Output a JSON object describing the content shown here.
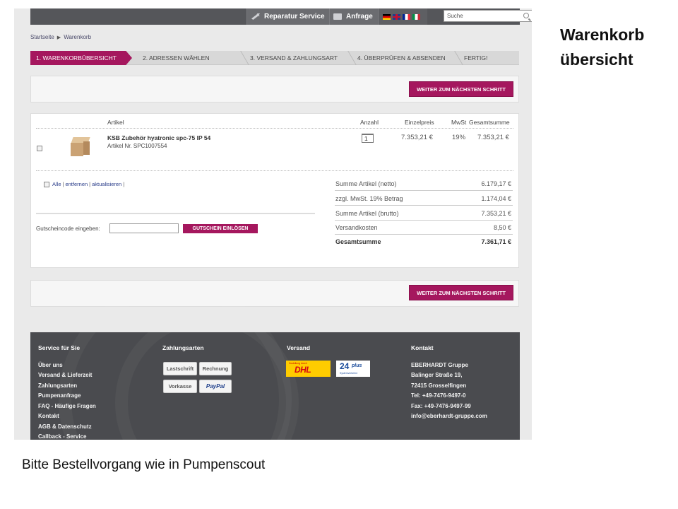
{
  "slide": {
    "title_line1": "Warenkorb",
    "title_line2": "übersicht",
    "note": "Bitte Bestellvorgang wie in Pumpenscout"
  },
  "topbar": {
    "repair_label": "Reparatur Service",
    "request_label": "Anfrage",
    "search_placeholder": "Suche",
    "icons": [
      "wrench-icon",
      "mail-icon",
      "flag-de-icon",
      "flag-uk-icon",
      "flag-fr-icon",
      "flag-it-icon",
      "search-icon"
    ]
  },
  "breadcrumb": {
    "home": "Startseite",
    "current": "Warenkorb"
  },
  "steps": [
    "1. WARENKORBÜBERSICHT",
    "2. ADRESSEN WÄHLEN",
    "3. VERSAND & ZAHLUNGSART",
    "4. ÜBERPRÜFEN & ABSENDEN",
    "FERTIG!"
  ],
  "next_button": "WEITER ZUM NÄCHSTEN SCHRITT",
  "cart": {
    "columns": {
      "article": "Artikel",
      "qty": "Anzahl",
      "unit_price": "Einzelpreis",
      "vat": "MwSt",
      "total": "Gesamtsumme"
    },
    "item": {
      "name": "KSB Zubehör hyatronic spc-75 IP 54",
      "number": "Artikel Nr. SPC1007554",
      "qty": "1",
      "unit_price": "7.353,21 €",
      "vat": "19%",
      "total": "7.353,21 €"
    },
    "links": {
      "all": "Alle",
      "remove": "entfernen",
      "update": "aktualisieren"
    },
    "coupon_label": "Gutscheincode eingeben:",
    "coupon_button": "GUTSCHEIN EINLÖSEN",
    "summary": [
      {
        "label": "Summe Artikel (netto)",
        "value": "6.179,17 €"
      },
      {
        "label": "zzgl. MwSt. 19% Betrag",
        "value": "1.174,04 €"
      },
      {
        "label": "Summe Artikel (brutto)",
        "value": "7.353,21 €"
      },
      {
        "label": "Versandkosten",
        "value": "8,50 €"
      },
      {
        "label": "Gesamtsumme",
        "value": "7.361,71 €"
      }
    ]
  },
  "footer": {
    "service": {
      "heading": "Service für Sie",
      "items": [
        "Über uns",
        "Versand & Lieferzeit",
        "Zahlungsarten",
        "Pumpenanfrage",
        "FAQ - Häufige Fragen",
        "Kontakt",
        "AGB & Datenschutz",
        "Callback - Service"
      ]
    },
    "payment": {
      "heading": "Zahlungsarten",
      "methods": [
        "Lastschrift",
        "Rechnung",
        "Vorkasse",
        "PayPal"
      ]
    },
    "shipping": {
      "heading": "Versand",
      "dhl_small": "Zustellung durch",
      "dhl": "DHL",
      "p24_big": "24",
      "p24_plus": "plus",
      "p24_sub": "Systemverkehre"
    },
    "contact": {
      "heading": "Kontakt",
      "lines": [
        "EBERHARDT Gruppe",
        "Balinger Straße 19,",
        "72415 Grosselfingen",
        "Tel: +49-7476-9497-0",
        "Fax: +49-7476-9497-99",
        "info@eberhardt-gruppe.com"
      ]
    }
  }
}
